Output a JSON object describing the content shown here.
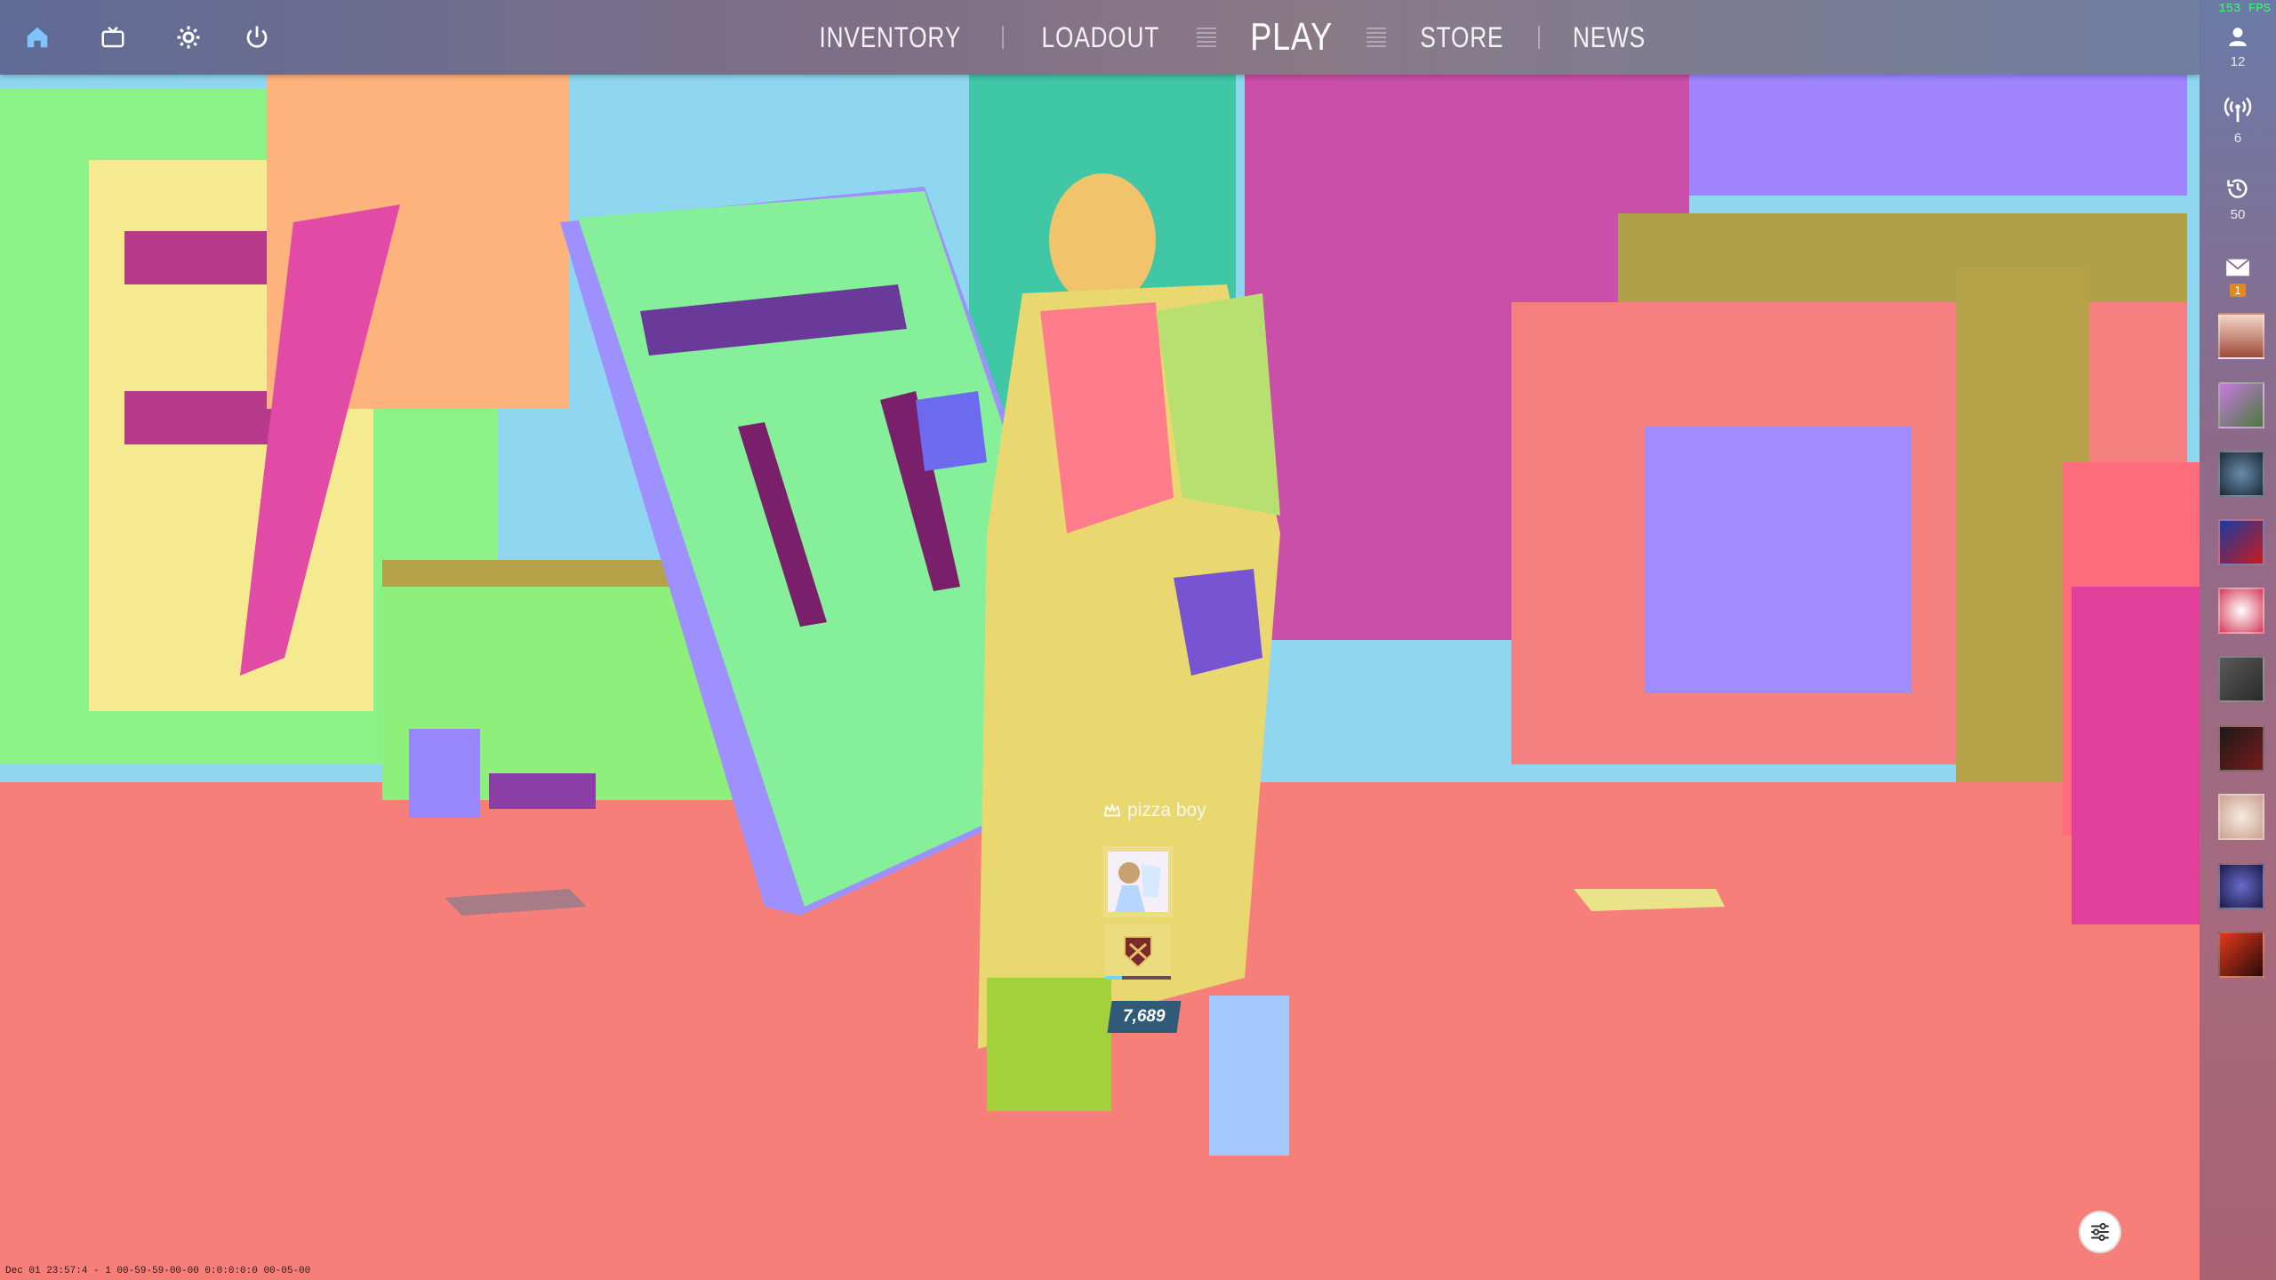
{
  "fps": "153 FPS",
  "topbar": {
    "icons": [
      "home-icon",
      "tv-icon",
      "gear-icon",
      "power-icon"
    ],
    "nav": [
      {
        "label": "INVENTORY",
        "active": false
      },
      {
        "label": "LOADOUT",
        "active": false
      },
      {
        "label": "PLAY",
        "active": true
      },
      {
        "label": "STORE",
        "active": false
      },
      {
        "label": "NEWS",
        "active": false
      }
    ]
  },
  "sidebar": {
    "friends_count": "12",
    "broadcast_count": "6",
    "history_count": "50",
    "mail_count": "1",
    "avatars": [
      "avatar-1",
      "avatar-2",
      "avatar-3",
      "avatar-4",
      "avatar-5",
      "avatar-6",
      "avatar-7",
      "avatar-8",
      "avatar-9",
      "avatar-10"
    ]
  },
  "player": {
    "name": "pizza boy",
    "score": "7,689",
    "xp_fraction": 0.25
  },
  "debug_text": "Dec 01 23:57:4 - 1 00-59-59-00-00 0:0:0:0:0 00-05-00",
  "colors": {
    "ground": "#f77f7a",
    "fps_text": "#3cff6a",
    "mail_badge": "#e08a1e",
    "score_bg": "#2f5a78"
  }
}
